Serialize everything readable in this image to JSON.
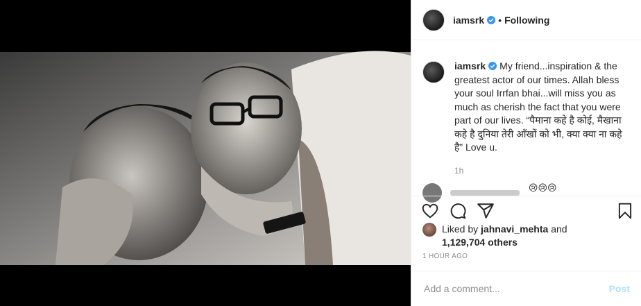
{
  "header": {
    "username": "iamsrk",
    "separator": "•",
    "follow_status": "Following"
  },
  "caption": {
    "username": "iamsrk",
    "text": "My friend...inspiration & the greatest actor of our times. Allah bless your soul Irrfan bhai...will miss you as much as cherish the fact that you were part of our lives. “पैमाना कहे है कोई, मैखाना कहे है दुनिया तेरी आँखों को भी, क्या क्या ना कहे है” Love u.",
    "time": "1h"
  },
  "next_comment": {
    "emoji": "😢😢😢"
  },
  "likes": {
    "prefix": "Liked by",
    "liker": "jahnavi_mehta",
    "conj": "and",
    "count": "1,129,704 others"
  },
  "timestamp": "1 HOUR AGO",
  "comment_box": {
    "placeholder": "Add a comment...",
    "post_label": "Post"
  },
  "colors": {
    "verified": "#3897f0",
    "post_disabled": "#b2dffc",
    "muted": "#8e8e8e"
  },
  "icons": [
    "heart-icon",
    "comment-icon",
    "share-icon",
    "bookmark-icon",
    "verified-badge-icon"
  ]
}
